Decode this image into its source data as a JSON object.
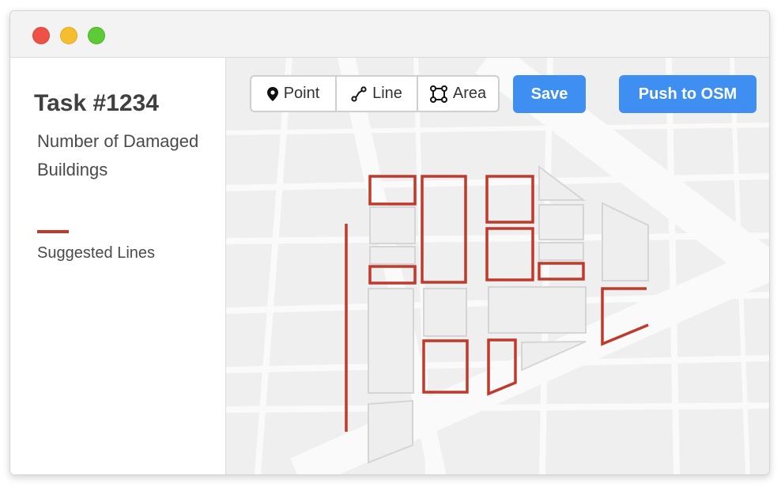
{
  "window": {
    "controls": [
      "close",
      "minimize",
      "maximize"
    ]
  },
  "sidebar": {
    "title": "Task #1234",
    "description": "Number of Damaged Buildings",
    "legend": {
      "label": "Suggested Lines",
      "color": "#c0392b"
    }
  },
  "toolbar": {
    "tools": [
      {
        "label": "Point",
        "icon": "map-pin-icon"
      },
      {
        "label": "Line",
        "icon": "line-segment-icon"
      },
      {
        "label": "Area",
        "icon": "polygon-area-icon"
      }
    ],
    "save_label": "Save",
    "push_label": "Push to OSM",
    "accent": "#3f8ff2"
  },
  "map": {
    "building_fill": "#eeeeee",
    "building_stroke": "#d5d5d5",
    "suggested_color": "#c0392b"
  }
}
